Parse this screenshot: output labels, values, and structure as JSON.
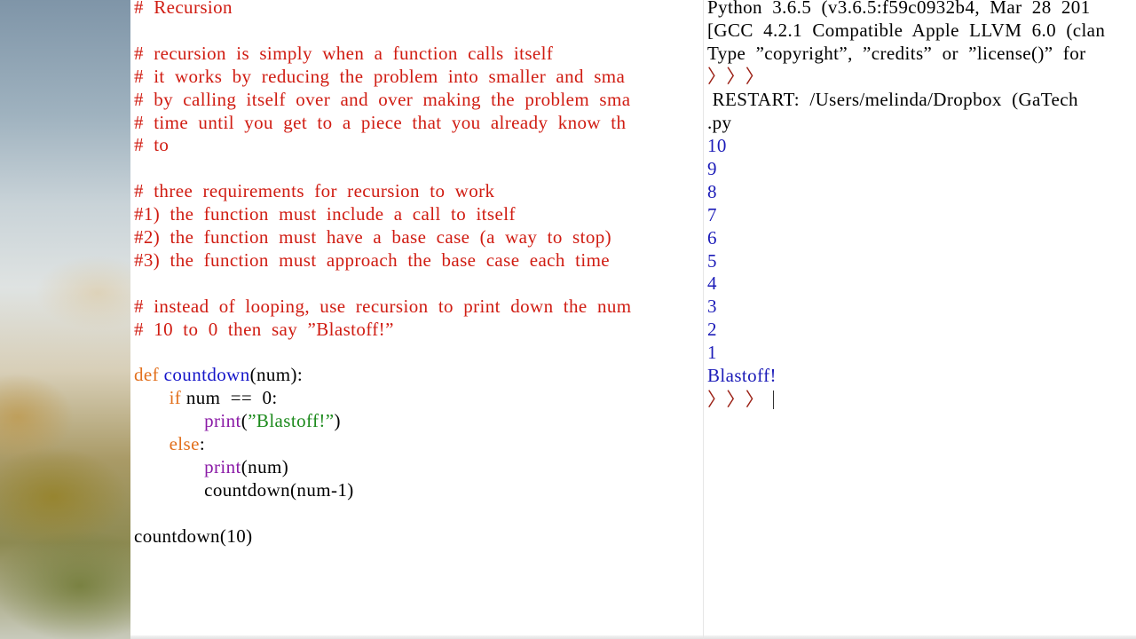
{
  "editor": {
    "lines": [
      {
        "comment": "#  Recursion"
      },
      {},
      {
        "comment": "#  recursion  is  simply  when  a  function  calls  itself"
      },
      {
        "comment": "#  it  works  by  reducing  the  problem  into  smaller  and  sma"
      },
      {
        "comment": "#  by  calling  itself  over  and  over  making  the  problem  sma"
      },
      {
        "comment": "#  time  until  you  get  to  a  piece  that  you  already  know  th"
      },
      {
        "comment": "#  to"
      },
      {},
      {
        "comment": "#  three  requirements  for  recursion  to  work"
      },
      {
        "comment": "#1)  the  function  must  include  a  call  to  itself"
      },
      {
        "comment": "#2)  the  function  must  have  a  base  case  (a  way  to  stop)"
      },
      {
        "comment": "#3)  the  function  must  approach  the  base  case  each  time"
      },
      {},
      {
        "comment": "#  instead  of  looping,  use  recursion  to  print  down  the  num"
      },
      {
        "comment": "#  10  to  0  then  say  ”Blastoff!”"
      },
      {},
      {
        "keyword": "def",
        "sp": " ",
        "defname": "countdown",
        "plain": "(num):"
      },
      {
        "indent": "       ",
        "keyword": "if",
        "plain": " num  ==  0:"
      },
      {
        "indent": "              ",
        "builtin": "print",
        "plain": "(",
        "string": "”Blastoff!”",
        "close": ")"
      },
      {
        "indent": "       ",
        "keyword": "else",
        "plain": ":"
      },
      {
        "indent": "              ",
        "builtin": "print",
        "plain": "(num)"
      },
      {
        "indent": "              ",
        "plain": "countdown(num-1)"
      },
      {},
      {
        "plain": "countdown(10)"
      }
    ]
  },
  "shell": {
    "header1": "Python  3.6.5  (v3.6.5:f59c0932b4,  Mar  28  201",
    "header2": "[GCC  4.2.1  Compatible  Apple  LLVM  6.0  (clan",
    "header3": "Type  ”copyright”,  ”credits”  or  ”license()”  for",
    "prompt": "〉〉〉",
    "restart": " RESTART:  /Users/melinda/Dropbox  (GaTech",
    "restart_cont": ".py",
    "outputs": [
      "10",
      "9",
      "8",
      "7",
      "6",
      "5",
      "4",
      "3",
      "2",
      "1",
      "Blastoff!"
    ],
    "final_prompt": "〉〉〉"
  }
}
